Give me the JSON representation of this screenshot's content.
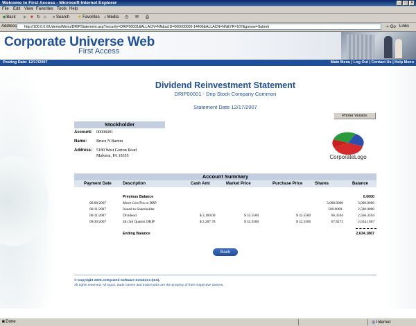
{
  "window": {
    "title": "Welcome to First Access - Microsoft Internet Explorer"
  },
  "menu": [
    "File",
    "Edit",
    "View",
    "Favorites",
    "Tools",
    "Help"
  ],
  "toolbar": {
    "back": "Back",
    "search": "Search",
    "favorites": "Favorites",
    "media": "Media"
  },
  "address": {
    "label": "Address",
    "url": "http://100.0.0.6/Udemo/Menu/DRIPStatement.asp?security=DRIP00001&ALLACN=NN&acID=000000000-14400&ALLACN=NN&YR=107&gonow=Submit",
    "go": "Go",
    "links": "Links"
  },
  "header": {
    "brand": "Corporate Universe Web",
    "sub": "First Access"
  },
  "navbar": {
    "date": "Posting Date: 12/17/2007",
    "links": "Main Menu | Log Out | Contact Us | Help Menu"
  },
  "statement": {
    "title": "Dividend Reinvestment Statement",
    "subtitle": "DRIP00001 - Drip Stock Company Common",
    "date": "Statement Date 12/17/2007",
    "printer_button": "Printer Version"
  },
  "stockholder": {
    "heading": "Stockholder",
    "account_label": "Account:",
    "account": "00008491",
    "name_label": "Name:",
    "name": "Bruce N Barton",
    "address_label": "Address:",
    "address1": "5180 West Gorton Road",
    "address2": "Malvern, PA 19355"
  },
  "logo": {
    "text": "CorporateLogo"
  },
  "summary": {
    "heading": "Account Summary",
    "columns": [
      "Payment Date",
      "Description",
      "Cash Amt",
      "Market Price",
      "Purchase Price",
      "Shares",
      "Balance"
    ],
    "rows": [
      {
        "date": "",
        "desc": "Previous Balance",
        "cash": "",
        "market": "",
        "purchase": "",
        "shares": "",
        "balance": "0.0000"
      },
      {
        "date": "06/08/2007",
        "desc": "Move Cert Pos to DRP",
        "cash": "",
        "market": "",
        "purchase": "",
        "shares": "3,000.0000",
        "balance": "3,000.0000"
      },
      {
        "date": "06/11/2007",
        "desc": "Issued to Shareholder",
        "cash": "",
        "market": "",
        "purchase": "",
        "shares": "500.0000-",
        "balance": "2,500.0000"
      },
      {
        "date": "06/11/2007",
        "desc": "Dividend",
        "cash": "$ 2,160.00",
        "market": "$ 32.5500",
        "purchase": "$ 32.5500",
        "shares": "66.3594",
        "balance": "2,566.3594"
      },
      {
        "date": "09/30/2007",
        "desc": "4th 3rd Quarter DRIP",
        "cash": "$ 2,287.78",
        "market": "$ 32.5500",
        "purchase": "$ 32.5500",
        "shares": "67.8273",
        "balance": "2,634.1867"
      }
    ],
    "ending_label": "Ending Balance",
    "ending_balance": "2,634.1867"
  },
  "back_button": "Back",
  "footer": {
    "copyright": "© Copyright 2000, Integrated Software Solutions (ISS).",
    "rights": "All rights reserved. All logos, trade names and trademarks are the property of their respective owners."
  },
  "status": {
    "left": "Done",
    "right": "Internet"
  },
  "colors": {
    "brand_blue": "#1f4f9a",
    "table_header": "#c3cfe0"
  }
}
